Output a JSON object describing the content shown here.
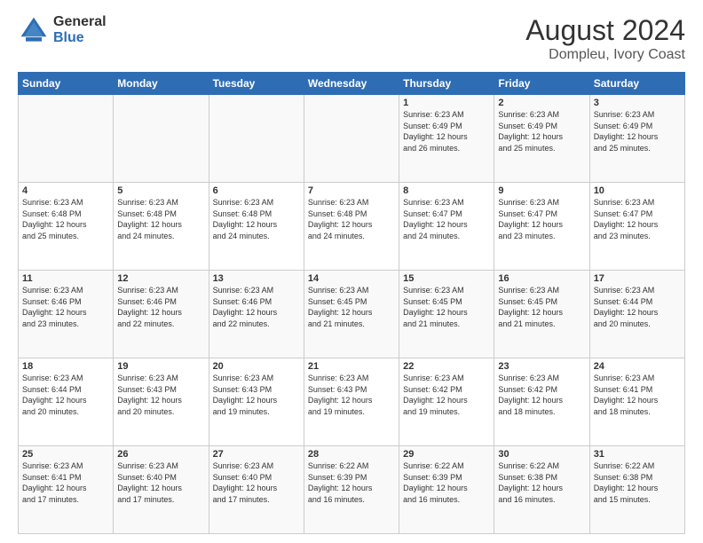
{
  "header": {
    "logo_general": "General",
    "logo_blue": "Blue",
    "title": "August 2024",
    "subtitle": "Dompleu, Ivory Coast"
  },
  "days_of_week": [
    "Sunday",
    "Monday",
    "Tuesday",
    "Wednesday",
    "Thursday",
    "Friday",
    "Saturday"
  ],
  "weeks": [
    [
      {
        "day": "",
        "info": ""
      },
      {
        "day": "",
        "info": ""
      },
      {
        "day": "",
        "info": ""
      },
      {
        "day": "",
        "info": ""
      },
      {
        "day": "1",
        "info": "Sunrise: 6:23 AM\nSunset: 6:49 PM\nDaylight: 12 hours\nand 26 minutes."
      },
      {
        "day": "2",
        "info": "Sunrise: 6:23 AM\nSunset: 6:49 PM\nDaylight: 12 hours\nand 25 minutes."
      },
      {
        "day": "3",
        "info": "Sunrise: 6:23 AM\nSunset: 6:49 PM\nDaylight: 12 hours\nand 25 minutes."
      }
    ],
    [
      {
        "day": "4",
        "info": "Sunrise: 6:23 AM\nSunset: 6:48 PM\nDaylight: 12 hours\nand 25 minutes."
      },
      {
        "day": "5",
        "info": "Sunrise: 6:23 AM\nSunset: 6:48 PM\nDaylight: 12 hours\nand 24 minutes."
      },
      {
        "day": "6",
        "info": "Sunrise: 6:23 AM\nSunset: 6:48 PM\nDaylight: 12 hours\nand 24 minutes."
      },
      {
        "day": "7",
        "info": "Sunrise: 6:23 AM\nSunset: 6:48 PM\nDaylight: 12 hours\nand 24 minutes."
      },
      {
        "day": "8",
        "info": "Sunrise: 6:23 AM\nSunset: 6:47 PM\nDaylight: 12 hours\nand 24 minutes."
      },
      {
        "day": "9",
        "info": "Sunrise: 6:23 AM\nSunset: 6:47 PM\nDaylight: 12 hours\nand 23 minutes."
      },
      {
        "day": "10",
        "info": "Sunrise: 6:23 AM\nSunset: 6:47 PM\nDaylight: 12 hours\nand 23 minutes."
      }
    ],
    [
      {
        "day": "11",
        "info": "Sunrise: 6:23 AM\nSunset: 6:46 PM\nDaylight: 12 hours\nand 23 minutes."
      },
      {
        "day": "12",
        "info": "Sunrise: 6:23 AM\nSunset: 6:46 PM\nDaylight: 12 hours\nand 22 minutes."
      },
      {
        "day": "13",
        "info": "Sunrise: 6:23 AM\nSunset: 6:46 PM\nDaylight: 12 hours\nand 22 minutes."
      },
      {
        "day": "14",
        "info": "Sunrise: 6:23 AM\nSunset: 6:45 PM\nDaylight: 12 hours\nand 21 minutes."
      },
      {
        "day": "15",
        "info": "Sunrise: 6:23 AM\nSunset: 6:45 PM\nDaylight: 12 hours\nand 21 minutes."
      },
      {
        "day": "16",
        "info": "Sunrise: 6:23 AM\nSunset: 6:45 PM\nDaylight: 12 hours\nand 21 minutes."
      },
      {
        "day": "17",
        "info": "Sunrise: 6:23 AM\nSunset: 6:44 PM\nDaylight: 12 hours\nand 20 minutes."
      }
    ],
    [
      {
        "day": "18",
        "info": "Sunrise: 6:23 AM\nSunset: 6:44 PM\nDaylight: 12 hours\nand 20 minutes."
      },
      {
        "day": "19",
        "info": "Sunrise: 6:23 AM\nSunset: 6:43 PM\nDaylight: 12 hours\nand 20 minutes."
      },
      {
        "day": "20",
        "info": "Sunrise: 6:23 AM\nSunset: 6:43 PM\nDaylight: 12 hours\nand 19 minutes."
      },
      {
        "day": "21",
        "info": "Sunrise: 6:23 AM\nSunset: 6:43 PM\nDaylight: 12 hours\nand 19 minutes."
      },
      {
        "day": "22",
        "info": "Sunrise: 6:23 AM\nSunset: 6:42 PM\nDaylight: 12 hours\nand 19 minutes."
      },
      {
        "day": "23",
        "info": "Sunrise: 6:23 AM\nSunset: 6:42 PM\nDaylight: 12 hours\nand 18 minutes."
      },
      {
        "day": "24",
        "info": "Sunrise: 6:23 AM\nSunset: 6:41 PM\nDaylight: 12 hours\nand 18 minutes."
      }
    ],
    [
      {
        "day": "25",
        "info": "Sunrise: 6:23 AM\nSunset: 6:41 PM\nDaylight: 12 hours\nand 17 minutes."
      },
      {
        "day": "26",
        "info": "Sunrise: 6:23 AM\nSunset: 6:40 PM\nDaylight: 12 hours\nand 17 minutes."
      },
      {
        "day": "27",
        "info": "Sunrise: 6:23 AM\nSunset: 6:40 PM\nDaylight: 12 hours\nand 17 minutes."
      },
      {
        "day": "28",
        "info": "Sunrise: 6:22 AM\nSunset: 6:39 PM\nDaylight: 12 hours\nand 16 minutes."
      },
      {
        "day": "29",
        "info": "Sunrise: 6:22 AM\nSunset: 6:39 PM\nDaylight: 12 hours\nand 16 minutes."
      },
      {
        "day": "30",
        "info": "Sunrise: 6:22 AM\nSunset: 6:38 PM\nDaylight: 12 hours\nand 16 minutes."
      },
      {
        "day": "31",
        "info": "Sunrise: 6:22 AM\nSunset: 6:38 PM\nDaylight: 12 hours\nand 15 minutes."
      }
    ]
  ]
}
